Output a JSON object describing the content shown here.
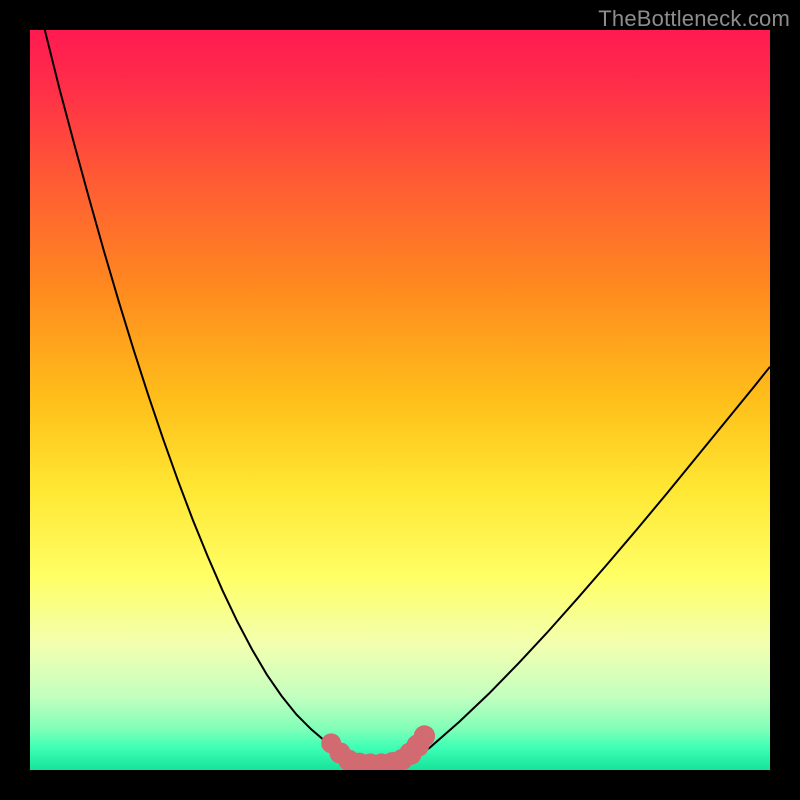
{
  "watermark": {
    "text": "TheBottleneck.com"
  },
  "colors": {
    "background": "#000000",
    "gradient_stops": [
      {
        "offset": 0.0,
        "color": "#ff1a52"
      },
      {
        "offset": 0.08,
        "color": "#ff2f49"
      },
      {
        "offset": 0.2,
        "color": "#ff5a34"
      },
      {
        "offset": 0.35,
        "color": "#ff8a1f"
      },
      {
        "offset": 0.5,
        "color": "#ffbf1a"
      },
      {
        "offset": 0.62,
        "color": "#ffe733"
      },
      {
        "offset": 0.74,
        "color": "#ffff66"
      },
      {
        "offset": 0.83,
        "color": "#f3ffb0"
      },
      {
        "offset": 0.9,
        "color": "#c4ffbf"
      },
      {
        "offset": 0.945,
        "color": "#7fffb8"
      },
      {
        "offset": 0.97,
        "color": "#3dffb5"
      },
      {
        "offset": 1.0,
        "color": "#16e39a"
      }
    ],
    "curve": "#000000",
    "marker": "#d16b71"
  },
  "chart_data": {
    "type": "line",
    "title": "",
    "xlabel": "",
    "ylabel": "",
    "xlim": [
      0,
      100
    ],
    "ylim": [
      0,
      100
    ],
    "series": [
      {
        "name": "left-curve",
        "x": [
          2,
          4,
          6,
          8,
          10,
          12,
          14,
          16,
          18,
          20,
          22,
          24,
          26,
          28,
          30,
          32,
          34,
          36,
          38,
          40,
          41,
          42,
          42.8
        ],
        "y": [
          100,
          92,
          84.5,
          77.2,
          70.1,
          63.3,
          56.8,
          50.6,
          44.7,
          39.1,
          33.8,
          28.9,
          24.3,
          20.1,
          16.3,
          12.9,
          10.0,
          7.5,
          5.5,
          3.8,
          2.9,
          2.0,
          1.3
        ]
      },
      {
        "name": "flat-bottom",
        "x": [
          42.8,
          44,
          46,
          48,
          50,
          51.6
        ],
        "y": [
          1.3,
          1.0,
          0.8,
          0.8,
          1.0,
          1.4
        ]
      },
      {
        "name": "right-curve",
        "x": [
          51.6,
          54,
          58,
          62,
          66,
          70,
          74,
          78,
          82,
          86,
          90,
          94,
          98,
          100
        ],
        "y": [
          1.4,
          3.0,
          6.5,
          10.3,
          14.4,
          18.7,
          23.2,
          27.8,
          32.5,
          37.3,
          42.2,
          47.1,
          52.0,
          54.5
        ]
      }
    ],
    "markers": {
      "name": "bottom-markers",
      "color_ref": "colors.marker",
      "points": [
        {
          "x": 40.7,
          "y": 3.6,
          "r": 0.9
        },
        {
          "x": 41.9,
          "y": 2.3,
          "r": 1.0
        },
        {
          "x": 43.1,
          "y": 1.3,
          "r": 1.0
        },
        {
          "x": 44.5,
          "y": 0.9,
          "r": 1.0
        },
        {
          "x": 46.0,
          "y": 0.8,
          "r": 1.0
        },
        {
          "x": 47.5,
          "y": 0.8,
          "r": 1.0
        },
        {
          "x": 49.0,
          "y": 1.0,
          "r": 1.0
        },
        {
          "x": 50.3,
          "y": 1.4,
          "r": 1.0
        },
        {
          "x": 51.4,
          "y": 2.2,
          "r": 1.1
        },
        {
          "x": 52.4,
          "y": 3.3,
          "r": 1.1
        },
        {
          "x": 53.3,
          "y": 4.6,
          "r": 1.0
        }
      ]
    }
  }
}
